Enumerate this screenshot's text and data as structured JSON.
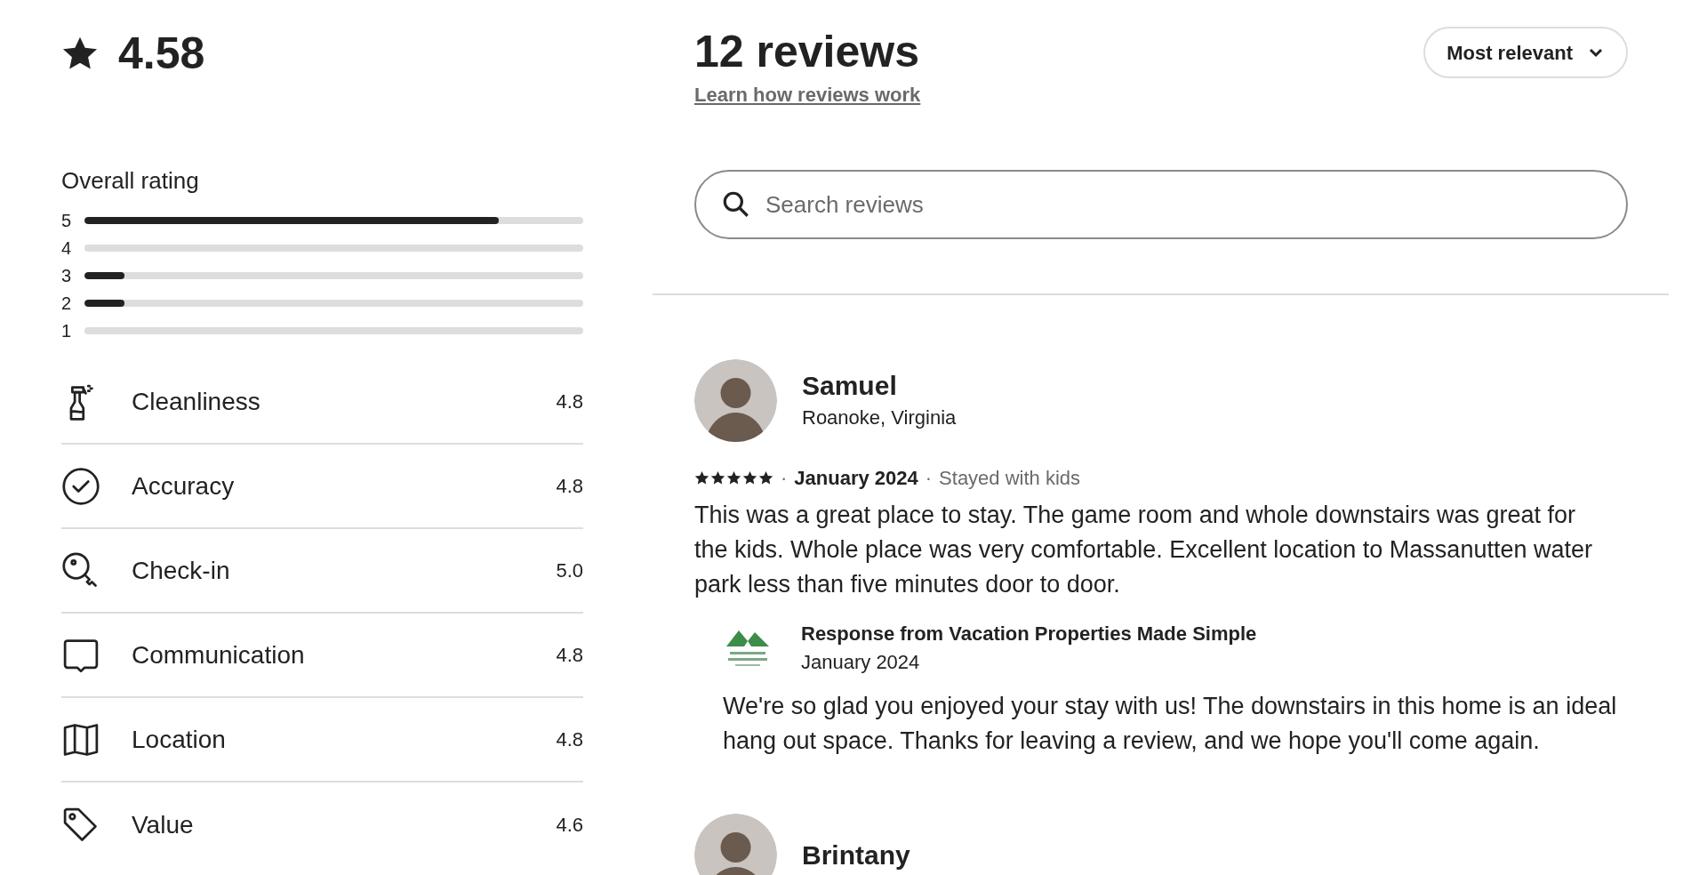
{
  "summary": {
    "score": "4.58",
    "overall_title": "Overall rating",
    "distribution": [
      {
        "label": "5",
        "level": 0.83
      },
      {
        "label": "4"
      },
      {
        "label": "3",
        "level": 0.08
      },
      {
        "label": "2",
        "level": 0.08
      },
      {
        "label": "1"
      }
    ],
    "categories": [
      {
        "kind": "spray",
        "label": "Cleanliness",
        "score": "4.8"
      },
      {
        "kind": "check",
        "label": "Accuracy",
        "score": "4.8"
      },
      {
        "kind": "key",
        "label": "Check-in",
        "score": "5.0"
      },
      {
        "kind": "chat",
        "label": "Communication",
        "score": "4.8"
      },
      {
        "kind": "map",
        "label": "Location",
        "score": "4.8"
      },
      {
        "kind": "tag",
        "label": "Value",
        "score": "4.6"
      }
    ]
  },
  "header": {
    "title": "12 reviews",
    "link": "Learn how reviews work",
    "sort": "Most relevant"
  },
  "search": {
    "placeholder": "Search reviews"
  },
  "reviews": [
    {
      "name": "Samuel",
      "location": "Roanoke, Virginia",
      "stars": 5,
      "separator": "·",
      "date": "January 2024",
      "trip": "Stayed with kids",
      "text": "This was a great place to stay.  The game room and whole downstairs was great for the kids.  Whole place was very comfortable.  Excellent location to Massanutten water park less than five minutes door to door.",
      "response": {
        "title": "Response from Vacation Properties Made Simple",
        "date": "January 2024",
        "text": "We're so glad you enjoyed your stay with us! The downstairs in this home is an ideal hang out space. Thanks for leaving a review, and we hope you'll come again."
      }
    },
    {
      "name": "Brintany"
    }
  ]
}
